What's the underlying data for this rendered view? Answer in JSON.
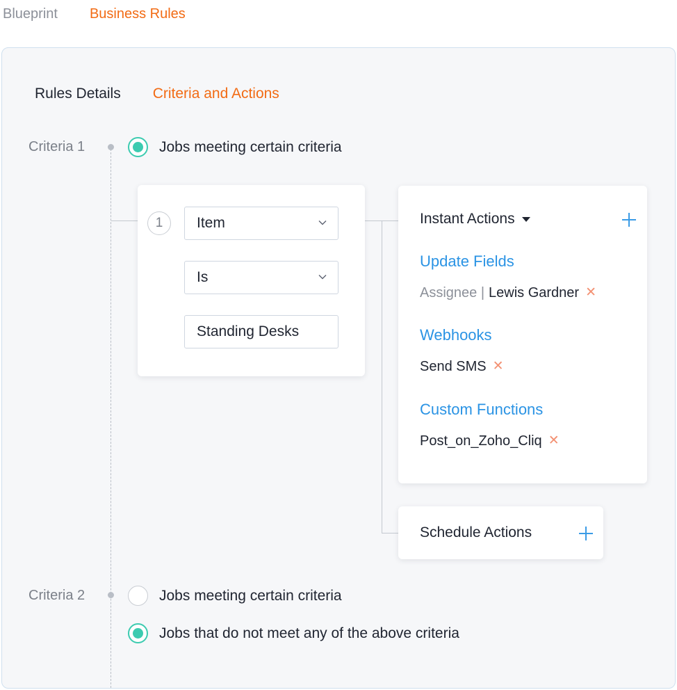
{
  "top_tabs": {
    "blueprint": "Blueprint",
    "business_rules": "Business Rules"
  },
  "sub_tabs": {
    "rules_details": "Rules Details",
    "criteria_actions": "Criteria and Actions"
  },
  "criteria1": {
    "label": "Criteria 1",
    "option": "Jobs meeting certain criteria",
    "condition": {
      "number": "1",
      "field": "Item",
      "operator": "Is",
      "value": "Standing Desks"
    }
  },
  "instant_actions": {
    "title": "Instant Actions",
    "update_fields": {
      "heading": "Update Fields",
      "item_label": "Assignee |",
      "item_value": "Lewis Gardner"
    },
    "webhooks": {
      "heading": "Webhooks",
      "item": "Send SMS"
    },
    "custom_functions": {
      "heading": "Custom Functions",
      "item": "Post_on_Zoho_Cliq"
    }
  },
  "schedule_actions": {
    "title": "Schedule Actions"
  },
  "criteria2": {
    "label": "Criteria 2",
    "option1": "Jobs meeting certain criteria",
    "option2": "Jobs that do not meet any of the above criteria"
  },
  "colors": {
    "accent_orange": "#f26b14",
    "link_blue": "#2a93e4",
    "radio_teal": "#3ccbb0",
    "remove_red": "#f39072"
  },
  "icons": {
    "dropdown": "chevron-down-icon",
    "menu": "caret-down-icon",
    "add": "plus-icon",
    "remove": "close-icon"
  }
}
